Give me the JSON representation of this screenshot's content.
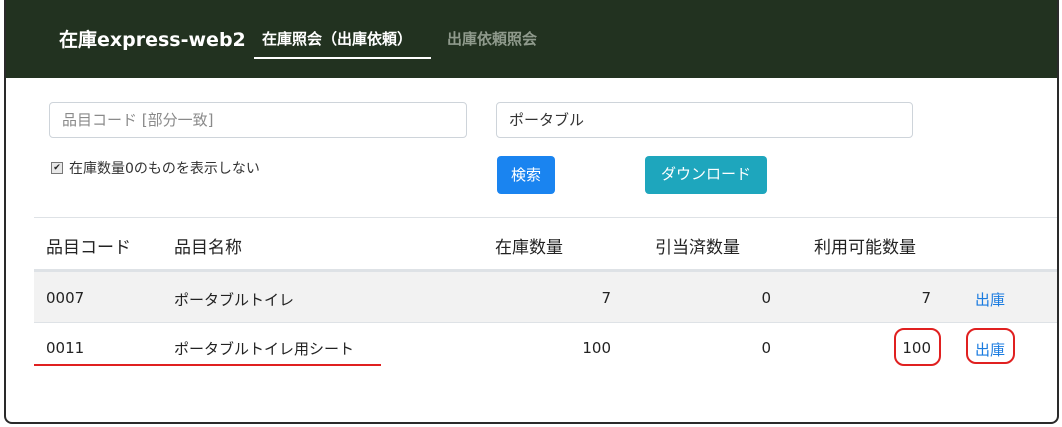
{
  "navbar": {
    "brand": "在庫express-web2",
    "tabs": [
      {
        "label": "在庫照会（出庫依頼）",
        "active": true
      },
      {
        "label": "出庫依頼照会",
        "active": false
      }
    ]
  },
  "search": {
    "item_code_placeholder": "品目コード [部分一致]",
    "item_name_value": "ポータブル",
    "hide_zero_checked": true,
    "hide_zero_label": "在庫数量0のものを表示しない",
    "search_button": "検索",
    "download_button": "ダウンロード"
  },
  "table": {
    "headers": [
      "品目コード",
      "品目名称",
      "在庫数量",
      "引当済数量",
      "利用可能数量"
    ],
    "rows": [
      {
        "code": "0007",
        "name": "ポータブルトイレ",
        "stock": "7",
        "allocated": "0",
        "available": "7",
        "action": "出庫"
      },
      {
        "code": "0011",
        "name": "ポータブルトイレ用シート",
        "stock": "100",
        "allocated": "0",
        "available": "100",
        "action": "出庫"
      }
    ]
  },
  "colors": {
    "navbar_bg": "#223220",
    "search_button": "#1a84f0",
    "download_button": "#1ea6bd",
    "link": "#1a7be0",
    "annotation_red": "#e02020"
  }
}
